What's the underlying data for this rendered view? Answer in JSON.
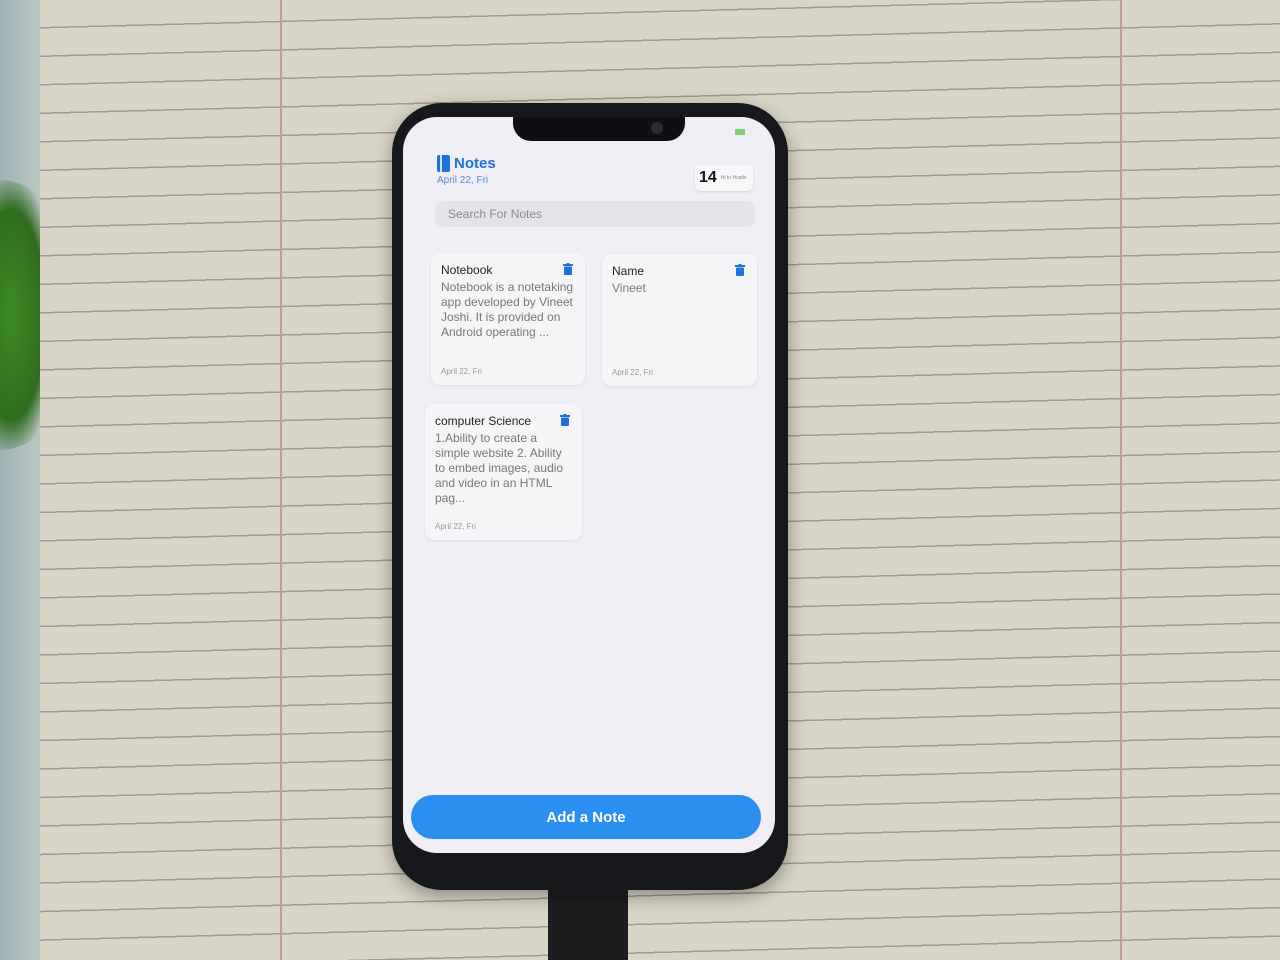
{
  "app": {
    "title": "Notes",
    "date": "April 22, Fri"
  },
  "date_widget": {
    "day": "14",
    "greeting": "Hi to Hustle"
  },
  "search": {
    "placeholder": "Search For Notes"
  },
  "notes": [
    {
      "title": "Notebook",
      "body": "Notebook is a notetaking app developed by Vineet Joshi. It is provided on Android operating ...",
      "date": "April 22, Fri"
    },
    {
      "title": "Name",
      "body": "Vineet",
      "date": "April 22, Fri"
    },
    {
      "title": "computer Science",
      "body": "1.Ability to create a simple website 2. Ability to embed images, audio and video in an HTML pag...",
      "date": "April 22, Fri"
    }
  ],
  "actions": {
    "add_label": "Add a Note"
  },
  "colors": {
    "accent": "#2b8ff2",
    "title_blue": "#1e73d8"
  },
  "icons": [
    "notebook-icon",
    "trash-icon"
  ]
}
